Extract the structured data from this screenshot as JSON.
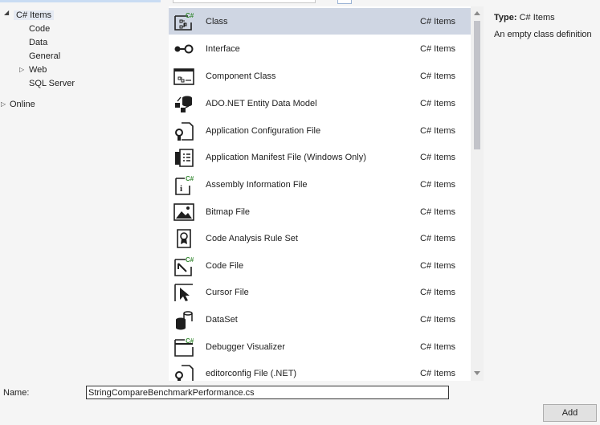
{
  "tree": {
    "csharp_items": "C# Items",
    "code": "Code",
    "data": "Data",
    "general": "General",
    "web": "Web",
    "sql_server": "SQL Server",
    "online": "Online"
  },
  "templates": [
    {
      "name": "Class",
      "category": "C# Items",
      "icon": "class-icon"
    },
    {
      "name": "Interface",
      "category": "C# Items",
      "icon": "interface-icon"
    },
    {
      "name": "Component Class",
      "category": "C# Items",
      "icon": "component-class-icon"
    },
    {
      "name": "ADO.NET Entity Data Model",
      "category": "C# Items",
      "icon": "entity-data-model-icon"
    },
    {
      "name": "Application Configuration File",
      "category": "C# Items",
      "icon": "config-file-icon"
    },
    {
      "name": "Application Manifest File (Windows Only)",
      "category": "C# Items",
      "icon": "manifest-file-icon"
    },
    {
      "name": "Assembly Information File",
      "category": "C# Items",
      "icon": "assembly-info-icon"
    },
    {
      "name": "Bitmap File",
      "category": "C# Items",
      "icon": "bitmap-file-icon"
    },
    {
      "name": "Code Analysis Rule Set",
      "category": "C# Items",
      "icon": "rule-set-icon"
    },
    {
      "name": "Code File",
      "category": "C# Items",
      "icon": "code-file-icon"
    },
    {
      "name": "Cursor File",
      "category": "C# Items",
      "icon": "cursor-file-icon"
    },
    {
      "name": "DataSet",
      "category": "C# Items",
      "icon": "dataset-icon"
    },
    {
      "name": "Debugger Visualizer",
      "category": "C# Items",
      "icon": "debugger-visualizer-icon"
    },
    {
      "name": "editorconfig File (.NET)",
      "category": "C# Items",
      "icon": "editorconfig-icon"
    }
  ],
  "details": {
    "type_label": "Type:",
    "type_value": "C# Items",
    "description": "An empty class definition"
  },
  "bottom": {
    "name_label": "Name:",
    "name_value": "StringCompareBenchmarkPerformance.cs",
    "add_label": "Add"
  },
  "colors": {
    "selection": "#cfd6e3",
    "csharp_badge": "#388a34",
    "icon": "#1e1e1e"
  }
}
